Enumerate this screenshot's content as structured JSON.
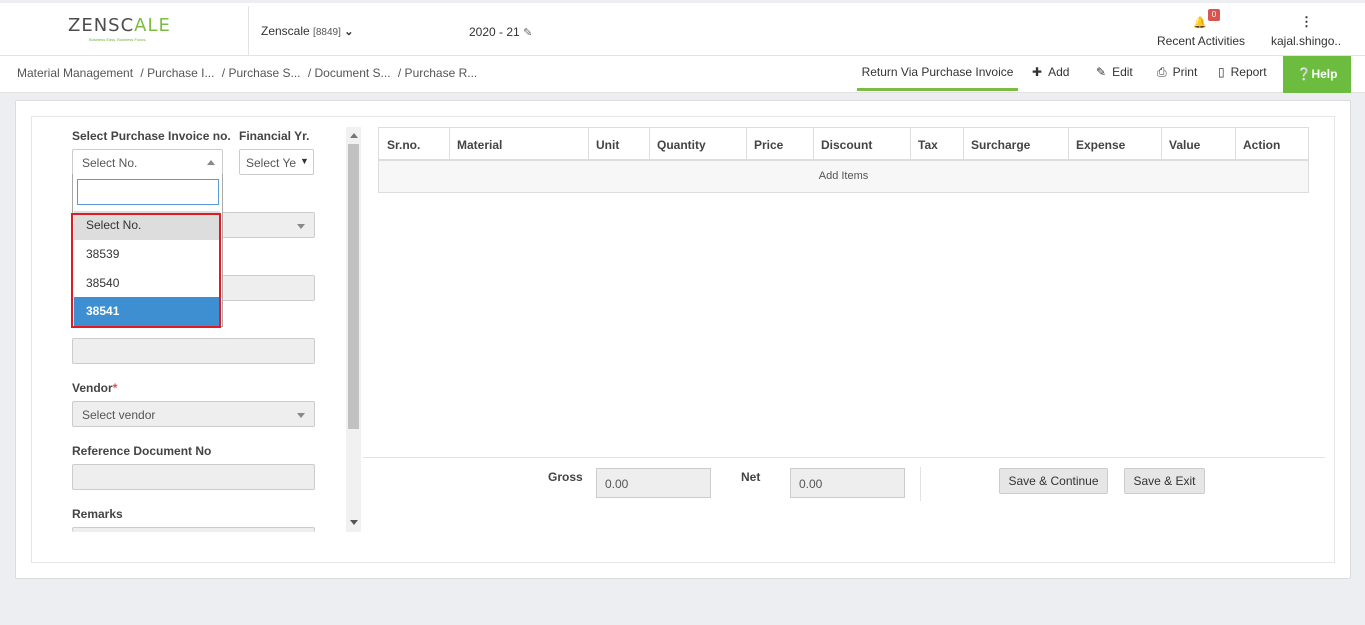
{
  "header": {
    "logo_main": "ZENSC",
    "logo_accent": "A",
    "logo_end": "LE",
    "logo_tagline": "Business Easy. Business Focus.",
    "company": "Zenscale",
    "company_code": "[8849]",
    "fiscal_year": "2020 - 21",
    "notification_count": "0",
    "recent_activities": "Recent Activities",
    "user": "kajal.shingo.."
  },
  "breadcrumb": {
    "items": [
      "Material Management",
      "/ Purchase I...",
      "/ Purchase S...",
      "/ Document S...",
      "/ Purchase R..."
    ]
  },
  "toolbar": {
    "active_tab": "Return Via Purchase Invoice",
    "add": "Add",
    "edit": "Edit",
    "print": "Print",
    "report": "Report",
    "help": "Help"
  },
  "form": {
    "invoice_label": "Select Purchase Invoice no.",
    "invoice_value": "Select No.",
    "fy_label": "Financial Yr.",
    "fy_value": "Select Ye",
    "vendor_label": "Vendor",
    "vendor_required": "*",
    "vendor_value": "Select vendor",
    "ref_doc_label": "Reference Document No",
    "remarks_label": "Remarks"
  },
  "dropdown": {
    "search_value": "",
    "options": [
      "Select No.",
      "38539",
      "38540",
      "38541"
    ],
    "highlighted": "38541"
  },
  "grid": {
    "columns": [
      "Sr.no.",
      "Material",
      "Unit",
      "Quantity",
      "Price",
      "Discount",
      "Tax",
      "Surcharge",
      "Expense",
      "Value",
      "Action"
    ],
    "empty_row": "Add Items"
  },
  "totals": {
    "gross_label": "Gross",
    "gross_value": "0.00",
    "net_label": "Net",
    "net_value": "0.00"
  },
  "buttons": {
    "save_continue": "Save & Continue",
    "save_exit": "Save & Exit"
  }
}
